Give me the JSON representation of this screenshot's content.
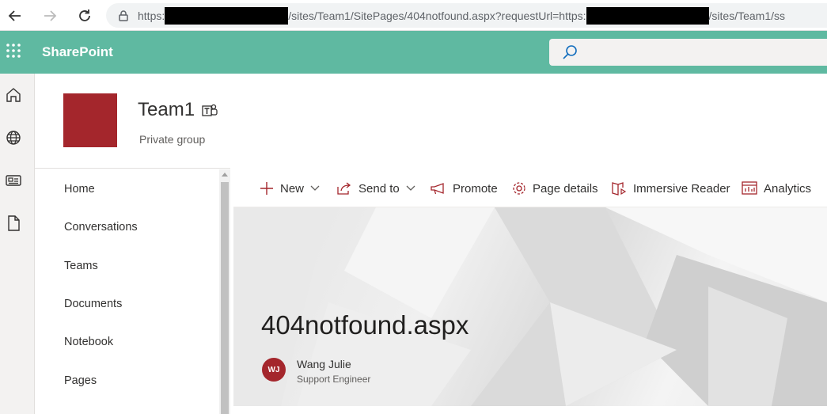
{
  "browser": {
    "url_prefix": "https:",
    "url_middle": "/sites/Team1/SitePages/404notfound.aspx?requestUrl=https:",
    "url_suffix": "/sites/Team1/ss"
  },
  "suitebar": {
    "brand": "SharePoint",
    "color": "#5fb9a1"
  },
  "site": {
    "title": "Team1",
    "subtitle": "Private group",
    "logo_color": "#a4262c"
  },
  "leftnav": {
    "items": [
      {
        "label": "Home"
      },
      {
        "label": "Conversations"
      },
      {
        "label": "Teams"
      },
      {
        "label": "Documents"
      },
      {
        "label": "Notebook"
      },
      {
        "label": "Pages"
      }
    ]
  },
  "commandbar": {
    "new": "New",
    "send_to": "Send to",
    "promote": "Promote",
    "page_details": "Page details",
    "immersive_reader": "Immersive Reader",
    "analytics": "Analytics"
  },
  "page": {
    "title": "404notfound.aspx",
    "author_initials": "WJ",
    "author_name": "Wang Julie",
    "author_role": "Support Engineer"
  },
  "icons": {
    "back": "arrow-left-icon",
    "forward": "arrow-right-icon",
    "reload": "reload-icon",
    "lock": "lock-icon",
    "waffle": "app-launcher-icon",
    "search": "search-icon",
    "rail": [
      "home-icon",
      "globe-icon",
      "news-icon",
      "file-icon"
    ]
  }
}
